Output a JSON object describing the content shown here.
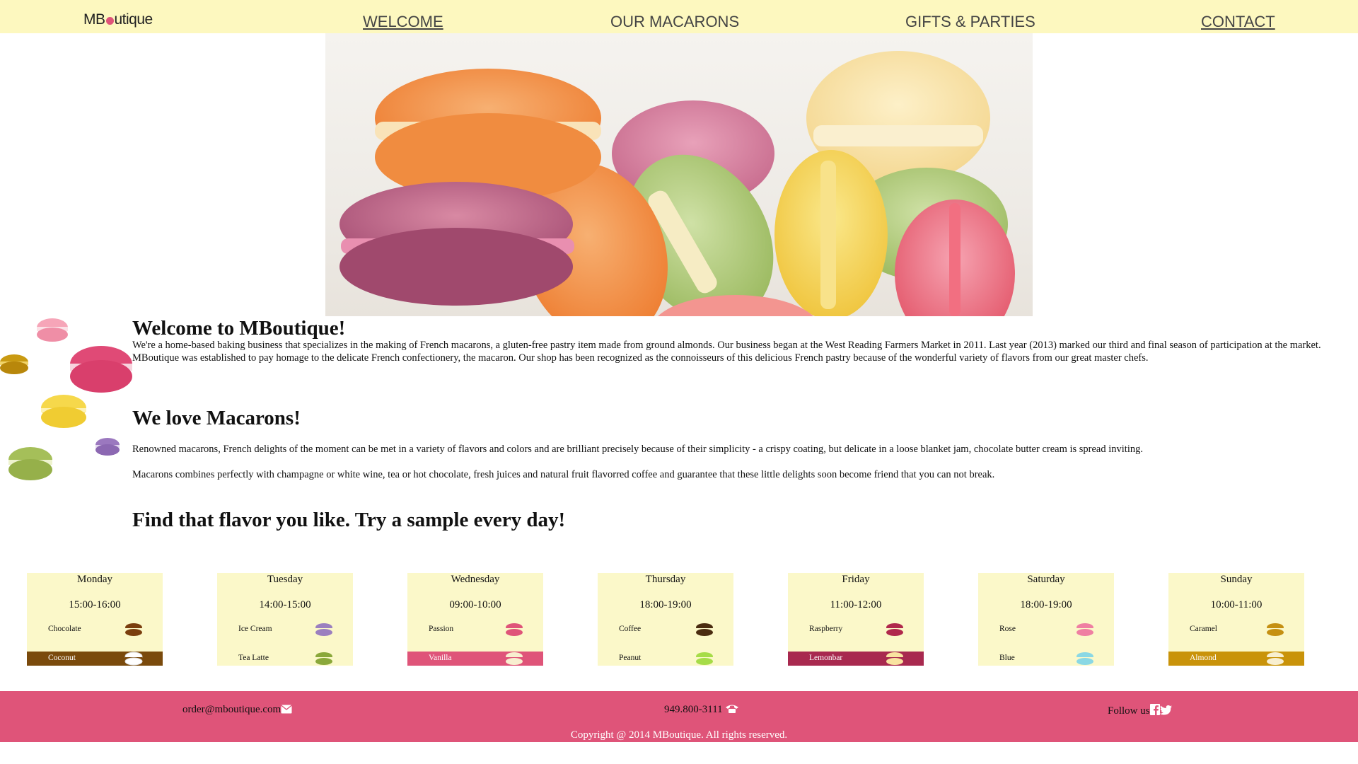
{
  "brand": {
    "logo_left": "MB",
    "logo_right": "utique"
  },
  "nav": {
    "welcome": "WELCOME",
    "macarons": "OUR MACARONS",
    "gifts": "GIFTS & PARTIES",
    "contact": "CONTACT"
  },
  "welcome": {
    "title": "Welcome to MBoutique!",
    "body": "We're a home-based baking business that specializes in the making of French macarons, a gluten-free pastry item made from ground almonds. Our business began at the West Reading Farmers Market in 2011. Last year (2013) marked our third and final season of participation at the market. MBoutique was established to pay homage to the delicate French confectionery, the macaron. Our shop has been recognized as the connoisseurs of this delicious French pastry because of the wonderful variety of flavors from our great master chefs."
  },
  "love": {
    "title": "We love Macarons!",
    "p1": "Renowned macarons, French delights of the moment can be met in a variety of flavors and colors and are brilliant precisely because of their simplicity - a crispy coating, but delicate in a loose blanket jam, chocolate butter cream is spread inviting.",
    "p2": "Macarons combines perfectly with champagne or white wine, tea or hot chocolate, fresh juices and natural fruit flavorred coffee and guarantee that these little delights soon become friend that you can not break."
  },
  "sample": {
    "title": "Find that flavor you like. Try a sample every day!"
  },
  "schedule": [
    {
      "day": "Monday",
      "time": "15:00-16:00",
      "flavor1": "Chocolate",
      "color1": "#7a3e0e",
      "flavor2": "Coconut",
      "color2": "#ffffff",
      "highlight": "#7a4a0c"
    },
    {
      "day": "Tuesday",
      "time": "14:00-15:00",
      "flavor1": "Ice Cream",
      "color1": "#9b7fbf",
      "flavor2": "Tea Latte",
      "color2": "#8aa83a",
      "highlight": ""
    },
    {
      "day": "Wednesday",
      "time": "09:00-10:00",
      "flavor1": "Passion",
      "color1": "#df5479",
      "flavor2": "Vanilla",
      "color2": "#f8efd0",
      "highlight": "#df5479"
    },
    {
      "day": "Thursday",
      "time": "18:00-19:00",
      "flavor1": "Coffee",
      "color1": "#4a2c10",
      "flavor2": "Peanut",
      "color2": "#a6dc48",
      "highlight": ""
    },
    {
      "day": "Friday",
      "time": "11:00-12:00",
      "flavor1": "Raspberry",
      "color1": "#b0284c",
      "flavor2": "Lemonbar",
      "color2": "#f9e3a0",
      "highlight": "#a8294f"
    },
    {
      "day": "Saturday",
      "time": "18:00-19:00",
      "flavor1": "Rose",
      "color1": "#ef7fa2",
      "flavor2": "Blue",
      "color2": "#8ad8e4",
      "highlight": ""
    },
    {
      "day": "Sunday",
      "time": "10:00-11:00",
      "flavor1": "Caramel",
      "color1": "#c59012",
      "flavor2": "Almond",
      "color2": "#f8efd0",
      "highlight": "#c9930a"
    }
  ],
  "footer": {
    "email": "order@mboutique.com",
    "phone": "949.800-3111",
    "follow": "Follow us",
    "copyright": "Copyright @ 2014 MBoutique. All rights reserved."
  },
  "colors": {
    "nav_bg": "#fdf8bf",
    "footer_bg": "#df5479",
    "card_bg": "#fbf8c9"
  },
  "icons": {
    "email": "envelope-icon",
    "phone": "phone-icon",
    "facebook": "facebook-icon",
    "twitter": "twitter-icon"
  }
}
